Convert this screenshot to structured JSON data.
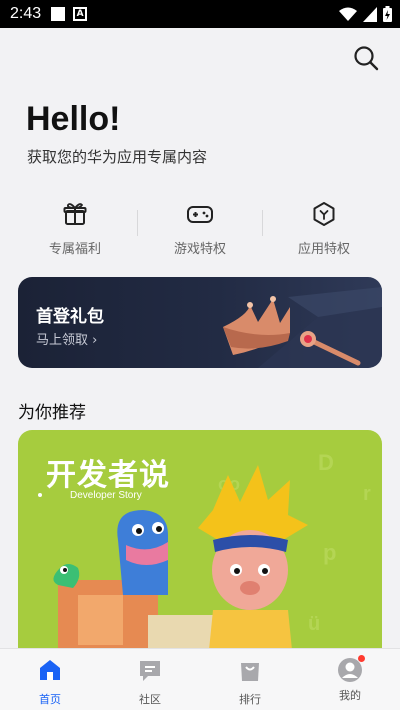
{
  "status_bar": {
    "time": "2:43",
    "icon_a_label": "A"
  },
  "header": {
    "greeting": "Hello!",
    "subtitle": "获取您的华为应用专属内容"
  },
  "benefits": [
    {
      "label": "专属福利",
      "icon": "gift-icon"
    },
    {
      "label": "游戏特权",
      "icon": "gamepad-icon"
    },
    {
      "label": "应用特权",
      "icon": "app-privilege-icon"
    }
  ],
  "gift_banner": {
    "title": "首登礼包",
    "link": "马上领取 ›"
  },
  "recommend": {
    "section_title": "为你推荐",
    "card_title": "开发者说",
    "card_subtitle": "Developer Story"
  },
  "bottom_nav": [
    {
      "label": "首页",
      "icon": "home-icon",
      "active": true
    },
    {
      "label": "社区",
      "icon": "chat-icon",
      "active": false
    },
    {
      "label": "排行",
      "icon": "bag-icon",
      "active": false
    },
    {
      "label": "我的",
      "icon": "avatar-icon",
      "active": false
    }
  ],
  "colors": {
    "accent": "#1a63f5",
    "banner_bg": "#1b2236",
    "card_bg": "#a6cc3e",
    "badge": "#ff3b30"
  }
}
